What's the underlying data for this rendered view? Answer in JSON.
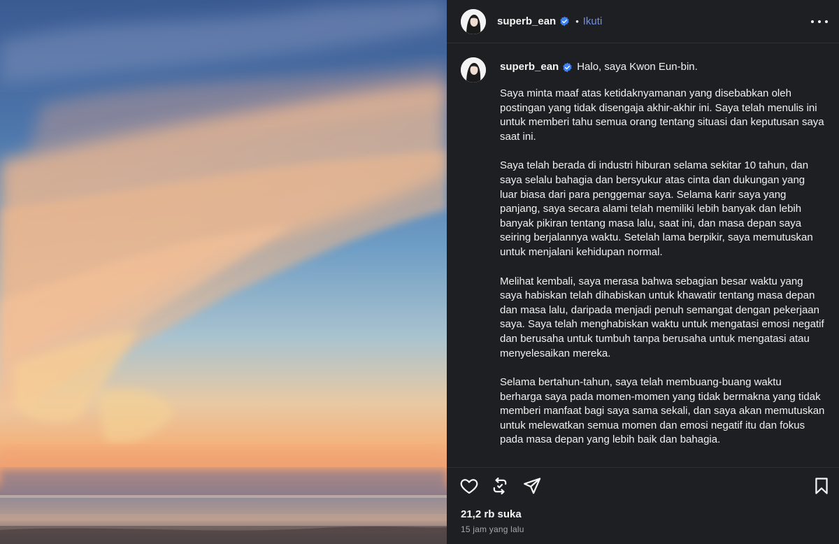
{
  "header": {
    "username": "superb_ean",
    "separator": "•",
    "follow_label": "Ikuti"
  },
  "caption": {
    "username": "superb_ean",
    "greeting": "Halo, saya Kwon Eun-bin.",
    "paragraphs": [
      "Saya minta maaf atas ketidaknyamanan yang disebabkan oleh postingan yang tidak disengaja akhir-akhir ini. Saya telah menulis ini untuk memberi tahu semua orang tentang situasi dan keputusan saya saat ini.",
      "Saya telah berada di industri hiburan selama sekitar 10 tahun, dan saya selalu bahagia dan bersyukur atas cinta dan dukungan yang luar biasa dari para penggemar saya. Selama karir saya yang panjang, saya secara alami telah memiliki lebih banyak dan lebih banyak pikiran tentang masa lalu, saat ini, dan masa depan saya seiring berjalannya waktu. Setelah lama berpikir, saya memutuskan untuk menjalani kehidupan normal.",
      "Melihat kembali, saya merasa bahwa sebagian besar waktu yang saya habiskan telah dihabiskan untuk khawatir tentang masa depan dan masa lalu, daripada menjadi penuh semangat dengan pekerjaan saya. Saya telah menghabiskan waktu untuk mengatasi emosi negatif dan berusaha untuk tumbuh tanpa berusaha untuk mengatasi atau menyelesaikan mereka.",
      "Selama bertahun-tahun, saya telah membuang-buang waktu berharga saya pada momen-momen yang tidak bermakna yang tidak memberi manfaat bagi saya sama sekali, dan saya akan memutuskan untuk melewatkan semua momen dan emosi negatif itu dan fokus pada masa depan yang lebih baik dan bahagia."
    ]
  },
  "footer": {
    "likes": "21,2 rb suka",
    "timestamp": "15 jam yang lalu"
  },
  "icons": {
    "verified": "verified-badge-icon",
    "more": "more-options-icon",
    "like": "heart-icon",
    "repost": "repost-icon",
    "share": "send-icon",
    "save": "bookmark-icon"
  },
  "colors": {
    "panel_bg": "#1e1f22",
    "accent": "#6f8df5",
    "verified": "#3b82f6",
    "muted": "#a8a8a8"
  }
}
